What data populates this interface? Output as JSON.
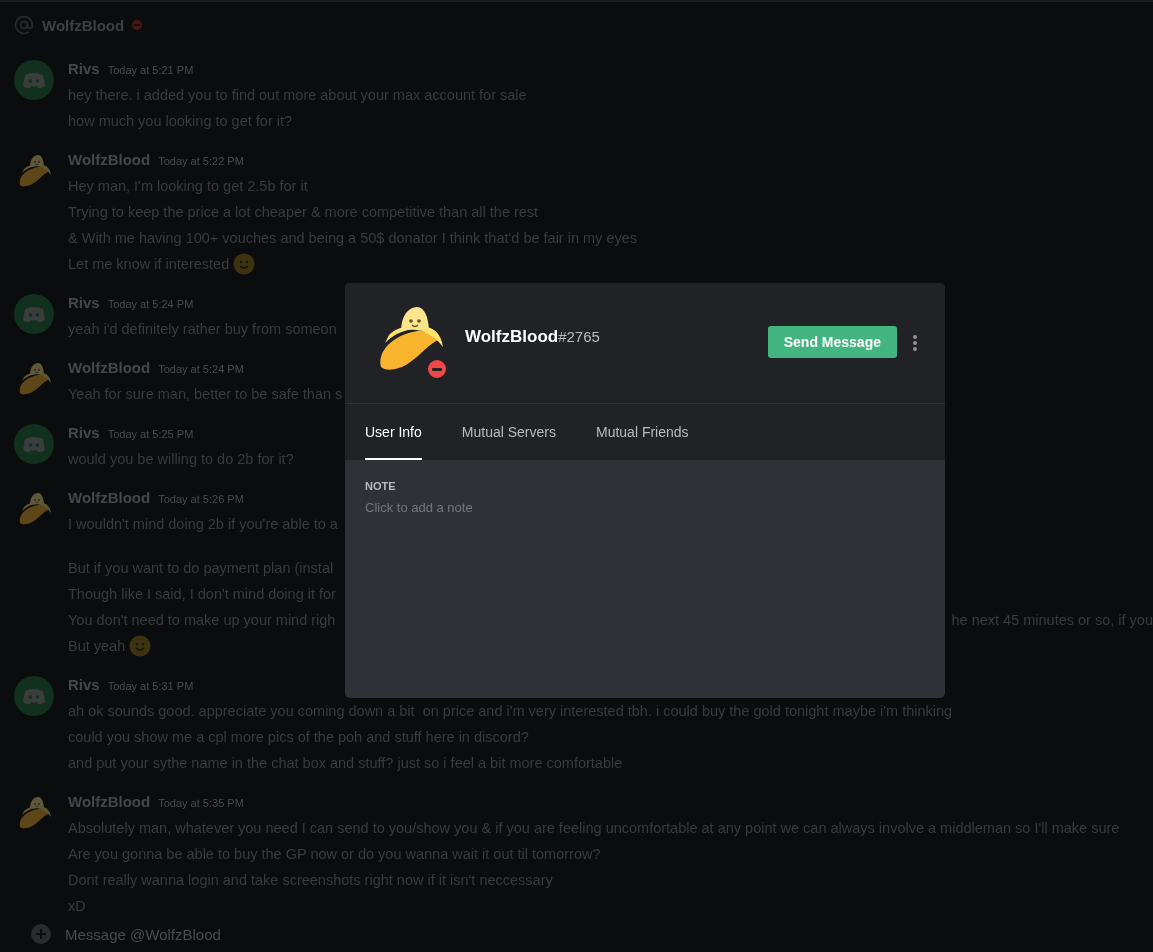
{
  "header": {
    "title": "WolfzBlood",
    "do_not_disturb": true
  },
  "messages": [
    {
      "author": "Rivs",
      "kind": "discord",
      "time": "Today at 5:21 PM",
      "lines": [
        {
          "text": "hey there. i added you to find out more about your max account for sale"
        },
        {
          "text": "how much you looking to get for it?"
        }
      ]
    },
    {
      "author": "WolfzBlood",
      "kind": "banana",
      "time": "Today at 5:22 PM",
      "lines": [
        {
          "text": "Hey man, I'm looking to get 2.5b for it"
        },
        {
          "text": "Trying to keep the price a lot cheaper & more competitive than all the rest"
        },
        {
          "text": "& With me having 100+ vouches and being a 50$ donator I think that'd be fair in my eyes"
        },
        {
          "text": "Let me know if interested",
          "smiley": true
        }
      ]
    },
    {
      "author": "Rivs",
      "kind": "discord",
      "time": "Today at 5:24 PM",
      "lines": [
        {
          "text": "yeah i'd definitely rather buy from someon"
        }
      ]
    },
    {
      "author": "WolfzBlood",
      "kind": "banana",
      "time": "Today at 5:24 PM",
      "lines": [
        {
          "text": "Yeah for sure man, better to be safe than s"
        }
      ]
    },
    {
      "author": "Rivs",
      "kind": "discord",
      "time": "Today at 5:25 PM",
      "lines": [
        {
          "text": "would you be willing to do 2b for it?"
        }
      ]
    },
    {
      "author": "WolfzBlood",
      "kind": "banana",
      "time": "Today at 5:26 PM",
      "lines": [
        {
          "text": "I wouldn't mind doing 2b if you're able to a"
        },
        {
          "text": "But if you want to do payment plan (instal",
          "break_before": true
        },
        {
          "text": "Though like I said, I don't mind doing it for"
        },
        {
          "text": "You don't need to make up your mind righ",
          "text_right": "he next 45 minutes or so, if you"
        },
        {
          "text": "But yeah",
          "smiley": true
        }
      ]
    },
    {
      "author": "Rivs",
      "kind": "discord",
      "time": "Today at 5:31 PM",
      "lines": [
        {
          "text": "ah ok sounds good. appreciate you coming down a bit  on price and i'm very interested tbh. i could buy the gold tonight maybe i'm thinking"
        },
        {
          "text": "could you show me a cpl more pics of the poh and stuff here in discord?"
        },
        {
          "text": "and put your sythe name in the chat box and stuff? just so i feel a bit more comfortable"
        }
      ]
    },
    {
      "author": "WolfzBlood",
      "kind": "banana",
      "time": "Today at 5:35 PM",
      "lines": [
        {
          "text": "Absolutely man, whatever you need I can send to you/show you & if you are feeling uncomfortable at any point we can always involve a middleman so I'll make sure"
        },
        {
          "text": "Are you gonna be able to buy the GP now or do you wanna wait it out til tomorrow?"
        },
        {
          "text": "Dont really wanna login and take screenshots right now if it isn't neccessary"
        },
        {
          "text": "xD"
        }
      ]
    }
  ],
  "composer": {
    "placeholder": "Message @WolfzBlood"
  },
  "profile": {
    "username": "WolfzBlood",
    "discriminator": "#2765",
    "do_not_disturb": true,
    "action_button": "Send Message",
    "tabs": [
      {
        "label": "User Info",
        "selected": true
      },
      {
        "label": "Mutual Servers",
        "selected": false
      },
      {
        "label": "Mutual Friends",
        "selected": false
      }
    ],
    "note": {
      "heading": "NOTE",
      "placeholder": "Click to add a note"
    }
  }
}
